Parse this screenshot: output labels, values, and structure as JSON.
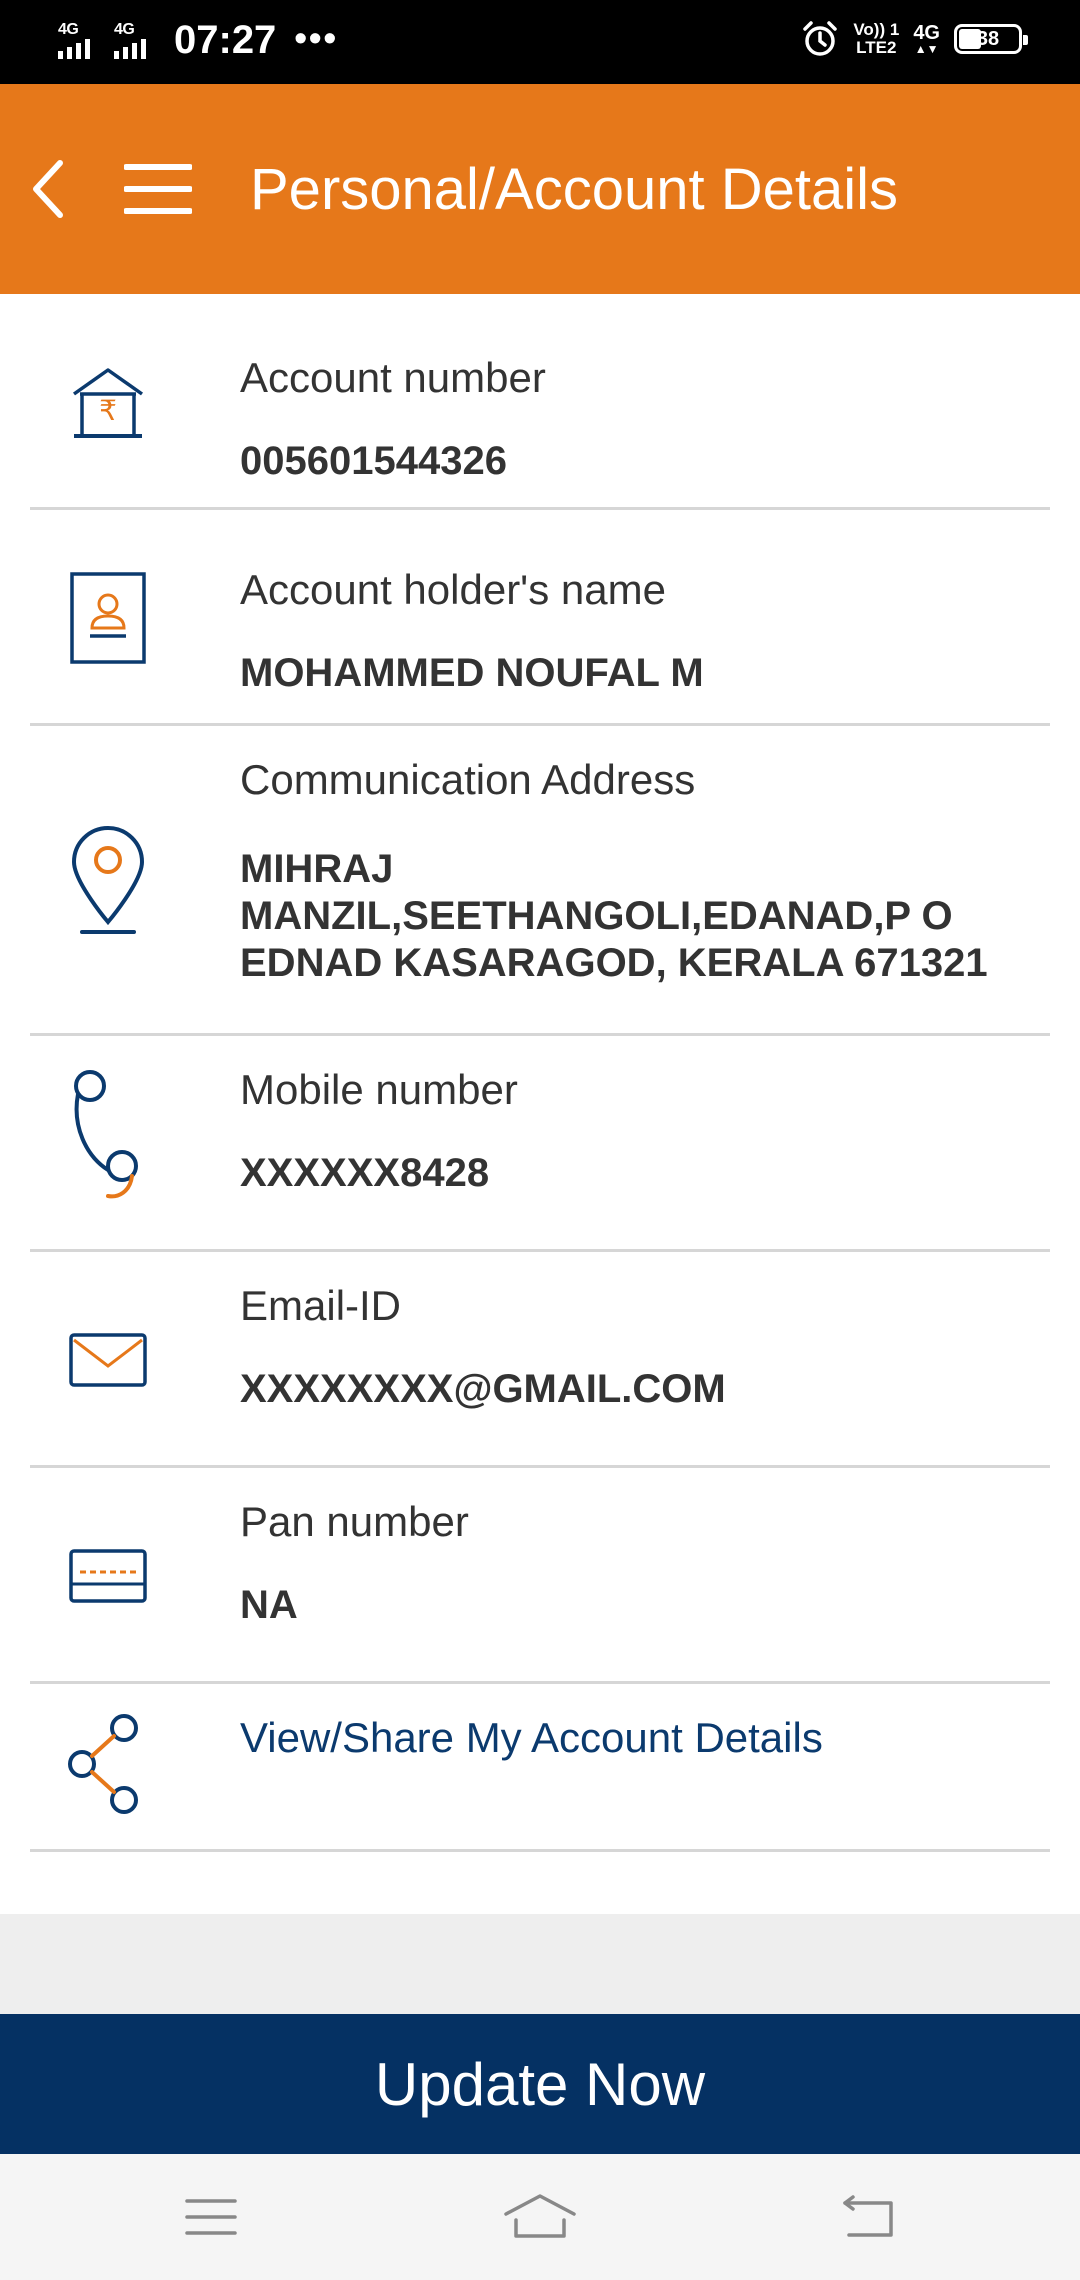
{
  "status_bar": {
    "network_1": "4G",
    "network_2": "4G",
    "time": "07:27",
    "dots": "•••",
    "volte_line1": "Vo)) 1",
    "volte_line2": "LTE2",
    "net_type": "4G",
    "battery": "38"
  },
  "header": {
    "title": "Personal/Account Details"
  },
  "details": [
    {
      "icon": "bank-rupee-icon",
      "label": "Account number",
      "value": "005601544326"
    },
    {
      "icon": "user-card-icon",
      "label": "Account holder's name",
      "value": "MOHAMMED NOUFAL M"
    },
    {
      "icon": "location-pin-icon",
      "label": "Communication Address",
      "value_lines": [
        "MIHRAJ",
        "MANZIL,SEETHANGOLI,EDANAD,P O",
        "EDNAD KASARAGOD, KERALA 671321"
      ]
    },
    {
      "icon": "phone-icon",
      "label": "Mobile number",
      "value": "XXXXXX8428"
    },
    {
      "icon": "mail-icon",
      "label": "Email-ID",
      "value": "XXXXXXXX@GMAIL.COM"
    },
    {
      "icon": "card-icon",
      "label": "Pan number",
      "value": "NA"
    }
  ],
  "share": {
    "icon": "share-icon",
    "label": "View/Share My Account Details"
  },
  "update_button": "Update Now",
  "colors": {
    "header_orange": "#E6781A",
    "navy": "#0B3A6E",
    "button_navy": "#053163"
  }
}
